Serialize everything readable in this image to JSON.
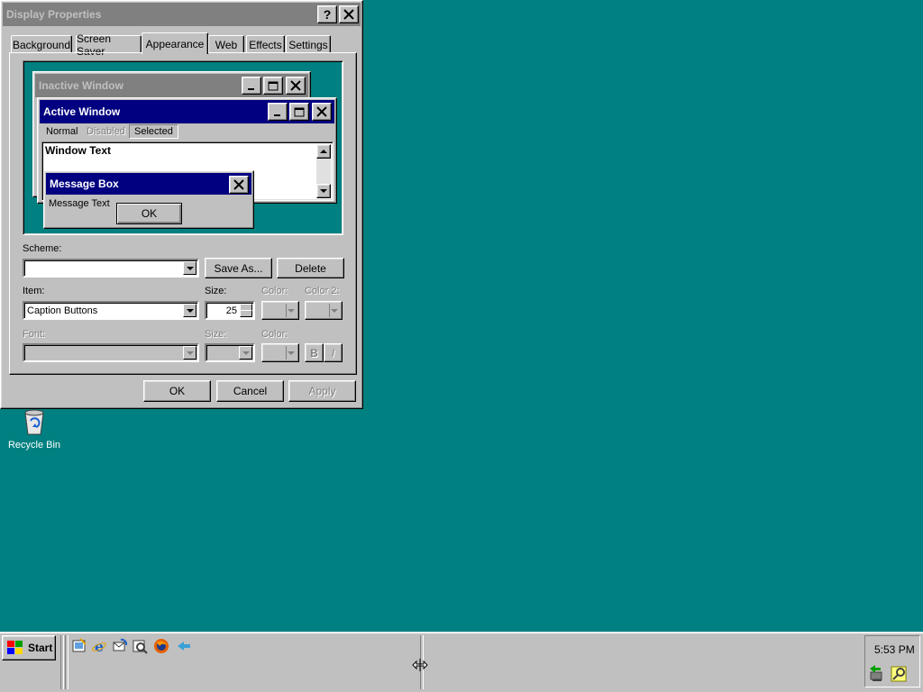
{
  "dialog": {
    "title": "Display Properties",
    "tabs": [
      "Background",
      "Screen Saver",
      "Appearance",
      "Web",
      "Effects",
      "Settings"
    ],
    "active_tab": "Appearance",
    "preview": {
      "inactive_title": "Inactive Window",
      "active_title": "Active Window",
      "menu": {
        "normal": "Normal",
        "disabled": "Disabled",
        "selected": "Selected"
      },
      "window_text": "Window Text",
      "msgbox_title": "Message Box",
      "msgbox_text": "Message Text",
      "msgbox_ok": "OK"
    },
    "scheme": {
      "label": "Scheme:",
      "value": "",
      "save_as": "Save As...",
      "delete": "Delete"
    },
    "item": {
      "label": "Item:",
      "value": "Caption Buttons",
      "size_label": "Size:",
      "size_value": "25",
      "color_label": "Color:",
      "color2_label": "Color 2:"
    },
    "font": {
      "label": "Font:",
      "value": "",
      "size_label": "Size:",
      "color_label": "Color:",
      "bold": "B",
      "italic": "I"
    },
    "buttons": {
      "ok": "OK",
      "cancel": "Cancel",
      "apply": "Apply"
    }
  },
  "desktop": {
    "recycle_bin": "Recycle Bin",
    "background_color": "#008080"
  },
  "taskbar": {
    "start": "Start",
    "clock": "5:53 PM",
    "quick_launch": [
      "show-desktop-icon",
      "internet-explorer-icon",
      "outlook-express-icon",
      "explorer-icon",
      "firefox-icon",
      "arrow-icon"
    ]
  },
  "colors": {
    "active_title": "#000080",
    "inactive_title": "#808080",
    "face": "#c0c0c0"
  }
}
